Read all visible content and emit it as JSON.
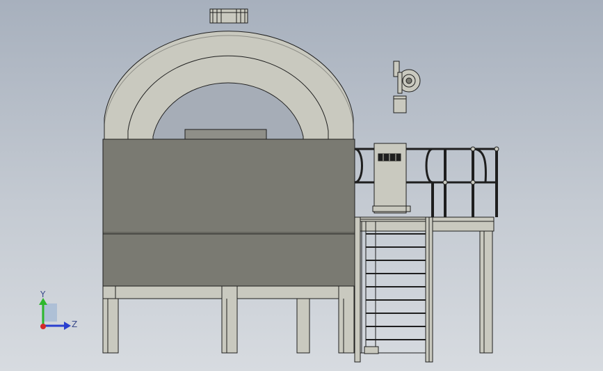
{
  "viewport": {
    "background_top": "#a7b0bd",
    "background_bottom": "#d7dbe0"
  },
  "model": {
    "body_color": "#7a7a72",
    "metal_color": "#c9c9bf",
    "edge_color": "#1e1e1e",
    "railing_color": "#c9c9bf",
    "blower_color": "#c9c9bf",
    "control_box_color": "#c9c9bf"
  },
  "triad": {
    "y_label": "Y",
    "z_label": "Z",
    "y_color": "#2db82d",
    "z_color": "#2a3fcf",
    "x_color": "#d42a2a",
    "label_color": "#3a4a8a"
  }
}
